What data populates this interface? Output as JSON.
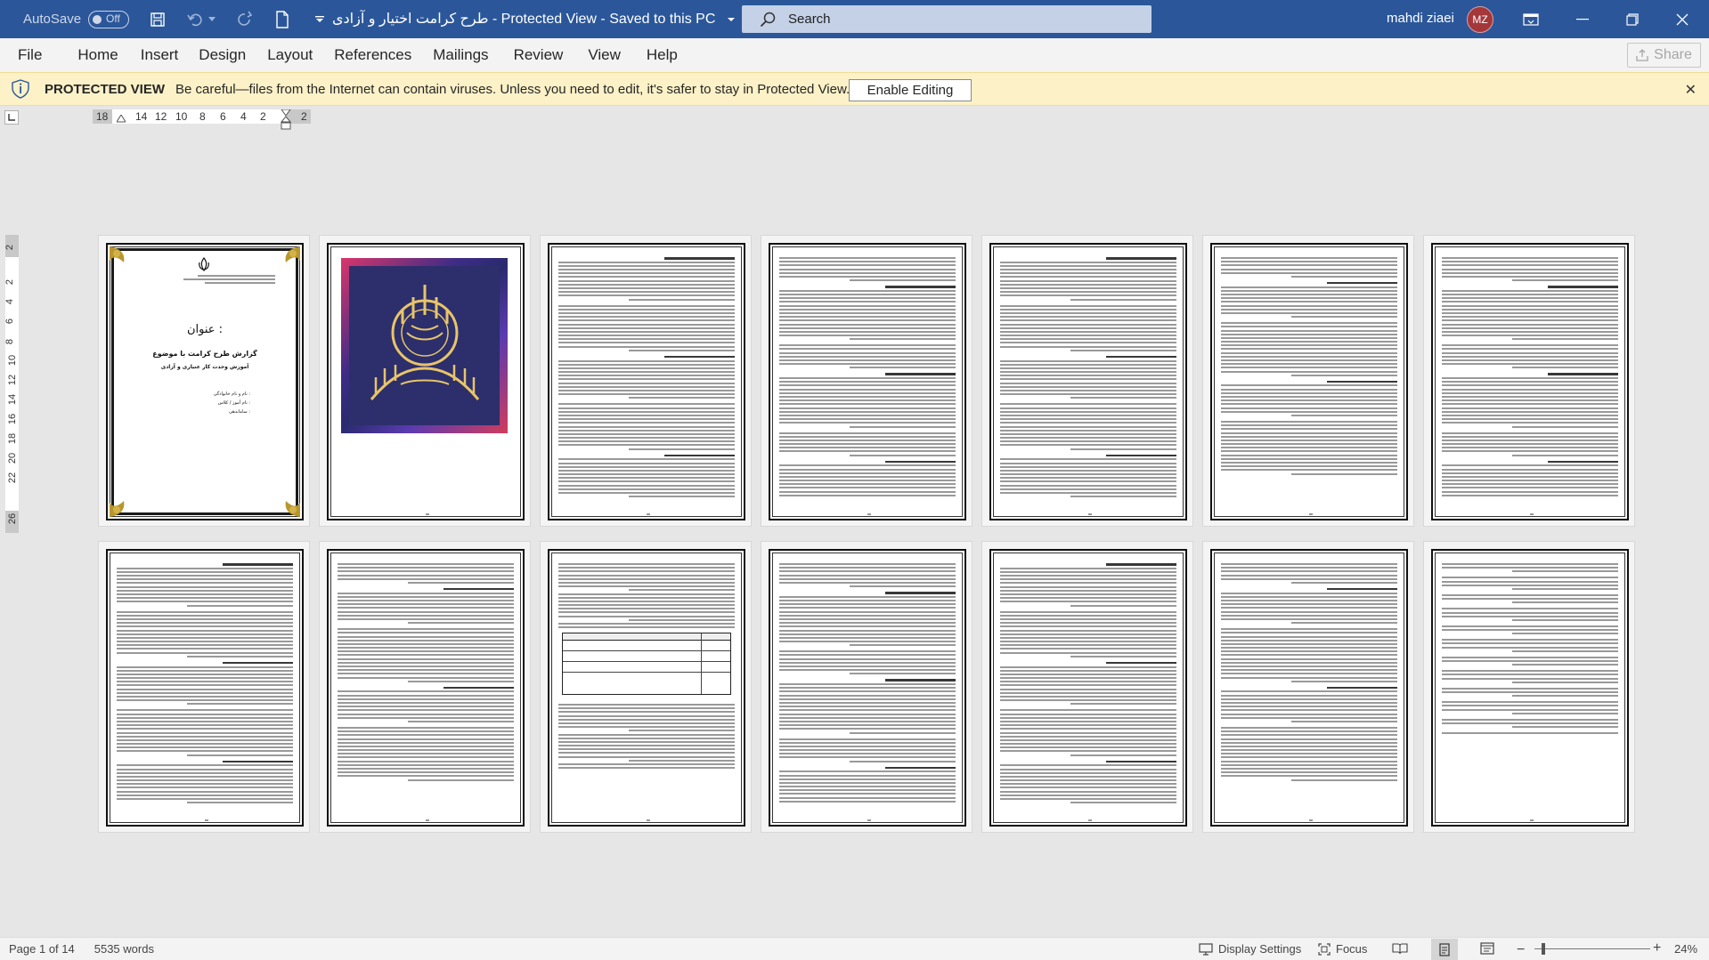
{
  "titlebar": {
    "autosave_label": "AutoSave",
    "autosave_state": "Off",
    "document_title": "طرح کرامت اختیار و آزادی  -  Protected View  -  Saved to this PC",
    "search_placeholder": "Search",
    "user_name": "mahdi ziaei",
    "user_initials": "MZ"
  },
  "menu": {
    "tabs": [
      "File",
      "Home",
      "Insert",
      "Design",
      "Layout",
      "References",
      "Mailings",
      "Review",
      "View",
      "Help"
    ],
    "share_label": "Share"
  },
  "protected_view": {
    "label": "PROTECTED VIEW",
    "message": "Be careful—files from the Internet can contain viruses. Unless you need to edit, it's safer to stay in Protected View.",
    "enable_button": "Enable Editing"
  },
  "ruler": {
    "horizontal_numbers": [
      "18",
      "14",
      "12",
      "10",
      "8",
      "6",
      "4",
      "2",
      "2"
    ],
    "vertical_numbers": [
      "2",
      "2",
      "4",
      "6",
      "8",
      "10",
      "12",
      "14",
      "16",
      "18",
      "20",
      "22",
      "26"
    ]
  },
  "cover_page": {
    "title": "عنوان :",
    "subtitle": "گزارش طرح کرامت با موضوع",
    "subtitle2": "آموزش وحدت کار عنیاری و آزادی",
    "info_lines": [
      "نام و نام خانوادگی :",
      "نام آموز / کلاس :",
      "ساماندهی :"
    ]
  },
  "status": {
    "page_info": "Page 1 of 14",
    "word_count": "5535 words",
    "display_settings": "Display Settings",
    "focus": "Focus",
    "zoom": "24%"
  },
  "colors": {
    "title_bar": "#2b579a",
    "protected_bar": "#fcf1c7",
    "avatar": "#a4373a"
  }
}
